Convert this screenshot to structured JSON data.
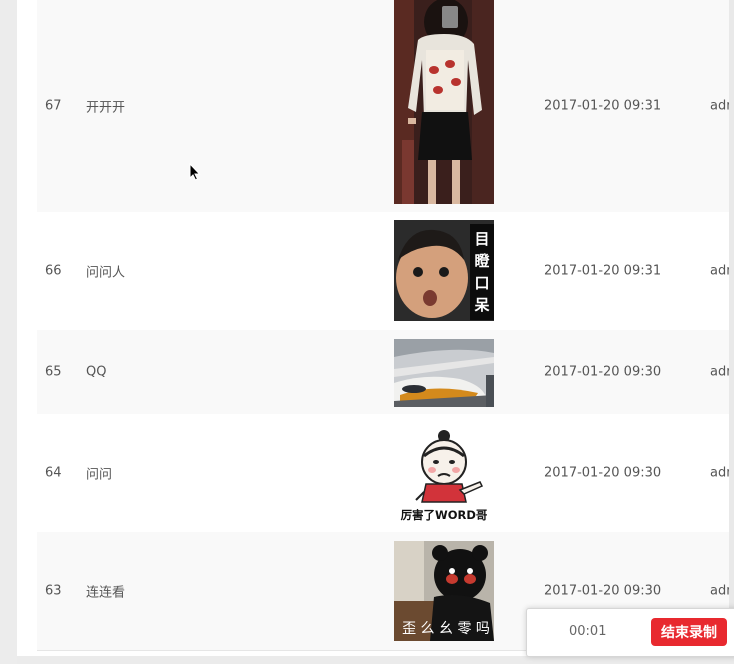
{
  "rows": [
    {
      "id": "67",
      "title": "开开开",
      "date": "2017-01-20 09:31",
      "user": "admin",
      "image": "woman-mirror-selfie"
    },
    {
      "id": "66",
      "title": "问问人",
      "date": "2017-01-20 09:31",
      "user": "admin",
      "image": "baby-meme",
      "image_text": [
        "目",
        "瞪",
        "口",
        "呆"
      ]
    },
    {
      "id": "65",
      "title": "QQ",
      "date": "2017-01-20 09:30",
      "user": "admin",
      "image": "high-speed-train"
    },
    {
      "id": "64",
      "title": "问问",
      "date": "2017-01-20 09:30",
      "user": "admin",
      "image": "cartoon-meme",
      "image_text": "厉害了WORD哥"
    },
    {
      "id": "63",
      "title": "连连看",
      "date": "2017-01-20 09:30",
      "user": "admin",
      "image": "bear-meme",
      "image_text": "歪 么 幺 零 吗"
    }
  ],
  "recorder": {
    "elapsed": "00:01",
    "stop_label": "结束录制",
    "accent": "#e8292f"
  }
}
